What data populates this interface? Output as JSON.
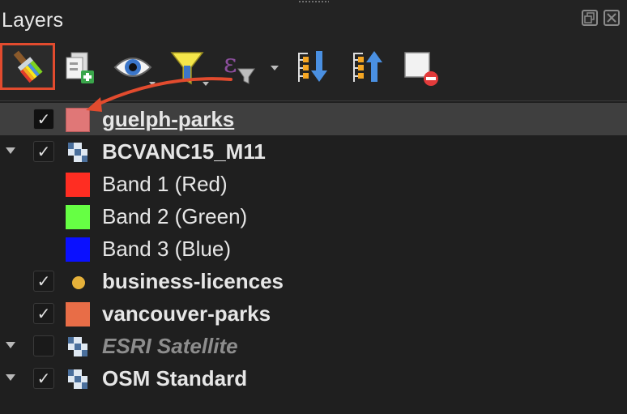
{
  "panel": {
    "title": "Layers"
  },
  "toolbar": {
    "buttons": [
      {
        "name": "open-layer-styling",
        "icon": "paintbrush-icon",
        "highlighted": true
      },
      {
        "name": "add-group",
        "icon": "add-group-icon"
      },
      {
        "name": "manage-map-themes",
        "icon": "eye-icon"
      },
      {
        "name": "filter-legend",
        "icon": "filter-icon"
      },
      {
        "name": "filter-by-expression",
        "icon": "expression-filter-icon"
      },
      {
        "name": "expand-all",
        "icon": "expand-all-icon"
      },
      {
        "name": "collapse-all",
        "icon": "collapse-all-icon"
      },
      {
        "name": "remove-layer",
        "icon": "remove-layer-icon"
      }
    ],
    "highlight_color": "#e24b2e"
  },
  "layers": [
    {
      "label": "guelph-parks",
      "checked": true,
      "selected": true,
      "type": "polygon",
      "color": "#e07777",
      "expandable": false
    },
    {
      "label": "BCVANC15_M11",
      "checked": true,
      "type": "raster",
      "expandable": true
    },
    {
      "label": "Band 1 (Red)",
      "type": "band",
      "color": "#ff2d22"
    },
    {
      "label": "Band 2 (Green)",
      "type": "band",
      "color": "#66ff44"
    },
    {
      "label": "Band 3 (Blue)",
      "type": "band",
      "color": "#0a10ff"
    },
    {
      "label": "business-licences",
      "checked": true,
      "type": "point",
      "color": "#e5b13a"
    },
    {
      "label": "vancouver-parks",
      "checked": true,
      "type": "polygon",
      "color": "#e86d47"
    },
    {
      "label": "ESRI Satellite",
      "checked": false,
      "type": "raster",
      "expandable": true,
      "disabled": true
    },
    {
      "label": "OSM Standard",
      "checked": true,
      "type": "raster",
      "expandable": true
    }
  ],
  "check_glyph": "✓",
  "annotation": {
    "arrow_color": "#e24b2e"
  }
}
